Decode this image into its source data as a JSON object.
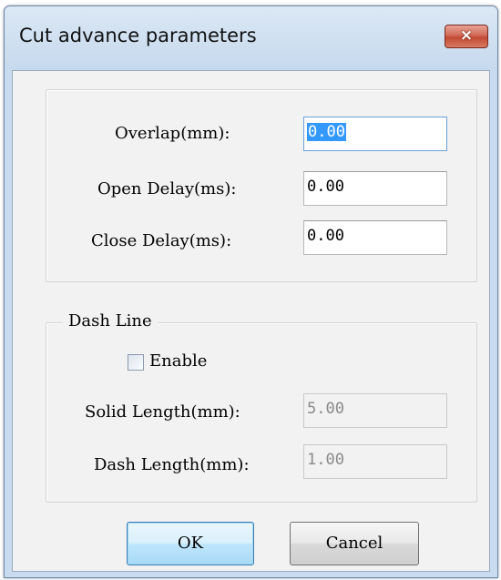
{
  "window": {
    "title": "Cut advance parameters",
    "close_icon": "×"
  },
  "params": {
    "overlap": {
      "label": "Overlap(mm):",
      "value": "0.00"
    },
    "open_delay": {
      "label": "Open Delay(ms):",
      "value": "0.00"
    },
    "close_delay": {
      "label": "Close Delay(ms):",
      "value": "0.00"
    }
  },
  "dash_line": {
    "group_label": "Dash Line",
    "enable": {
      "label": "Enable",
      "checked": false
    },
    "solid_length": {
      "label": "Solid Length(mm):",
      "value": "5.00"
    },
    "dash_length": {
      "label": "Dash Length(mm):",
      "value": "1.00"
    }
  },
  "buttons": {
    "ok": "OK",
    "cancel": "Cancel"
  }
}
